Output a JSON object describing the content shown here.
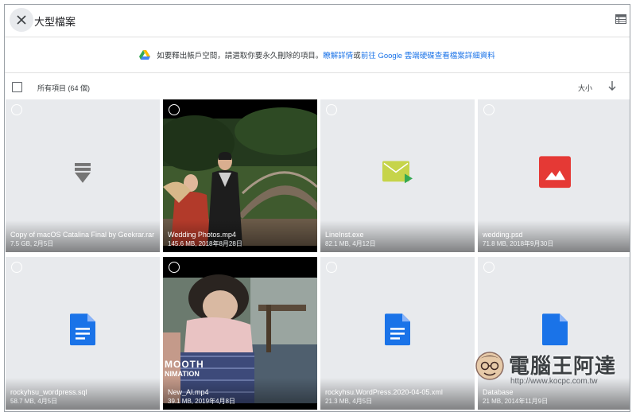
{
  "header": {
    "title": "大型檔案",
    "close_icon": "close-icon",
    "view_icon": "list-view-icon"
  },
  "banner": {
    "message": "如要釋出帳戶空間，請選取你要永久刪除的項目。",
    "link1": "瞭解詳情",
    "connector": "或",
    "link2": "前往 Google 雲端硬碟查看檔案詳細資料"
  },
  "listbar": {
    "all_label": "所有項目 (64 個)",
    "sort_label": "大小"
  },
  "files": [
    {
      "name": "Copy of macOS Catalina Final by Geekrar.rar",
      "meta": "7.5 GB, 2月5日",
      "icon": "archive-icon",
      "color": "#757575"
    },
    {
      "name": "Wedding Photos.mp4",
      "meta": "145.6 MB, 2018年8月28日",
      "icon": "video-thumbnail",
      "color": "#000000"
    },
    {
      "name": "LineInst.exe",
      "meta": "82.1 MB, 4月12日",
      "icon": "exe-icon",
      "color": "#c6d44a"
    },
    {
      "name": "wedding.psd",
      "meta": "71.8 MB, 2018年9月30日",
      "icon": "image-icon",
      "color": "#e53935"
    },
    {
      "name": "rockyhsu_wordpress.sql",
      "meta": "58.7 MB, 4月5日",
      "icon": "doc-icon",
      "color": "#1a73e8"
    },
    {
      "name": "New_AI.mp4",
      "meta": "39.1 MB, 2019年4月8日",
      "icon": "video-thumbnail",
      "color": "#000000"
    },
    {
      "name": "rockyhsu.WordPress.2020-04-05.xml",
      "meta": "21.3 MB, 4月5日",
      "icon": "doc-icon",
      "color": "#1a73e8"
    },
    {
      "name": "Database",
      "meta": "21 MB, 2014年11月9日",
      "icon": "doc-icon",
      "color": "#1a73e8"
    }
  ],
  "photo_text": {
    "new_ai_overlay_1": "MOOTH",
    "new_ai_overlay_2": "NIMATION"
  },
  "watermark": {
    "text": "電腦王阿達",
    "url": "http://www.kocpc.com.tw"
  }
}
